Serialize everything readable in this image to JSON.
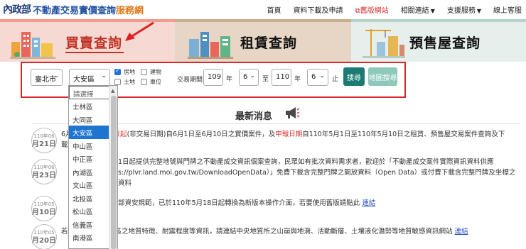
{
  "header": {
    "logo_mark": "內政部",
    "logo_main": "不動產交易實價查詢",
    "logo_accent": "服務網",
    "nav": {
      "home": "首頁",
      "download": "資料下載及申請",
      "old_site": "舊版網站",
      "related": "相關連結",
      "support": "支援服務",
      "service": "線上客服"
    }
  },
  "tabs": {
    "buy": "買賣查詢",
    "rent": "租賃查詢",
    "presale": "預售屋查詢"
  },
  "search": {
    "city": "臺北市",
    "district": "大安區",
    "types": {
      "house": "房地",
      "building": "建物",
      "land": "土地",
      "parking": "車位"
    },
    "period_label": "交易期間：",
    "from_year": "109",
    "from_month": "6",
    "to_year": "110",
    "to_month": "6",
    "year_unit": "年",
    "to_word": "至",
    "end_word": "止",
    "search_button": "搜尋",
    "map_button": "地圖搜尋"
  },
  "district_options": [
    "請選擇",
    "士林區",
    "大同區",
    "大安區",
    "中山區",
    "中正區",
    "內湖區",
    "文山區",
    "北投區",
    "松山區",
    "信義區",
    "南港區"
  ],
  "news": {
    "title": "最新消息",
    "items": [
      {
        "year_label": "110年06",
        "day_label": "月21日",
        "line1_a": "6月",
        "line1_b": "日起",
        "line1_c": "(非交易日期)自6月1日至6月10日之實價案件，及",
        "line1_d": "申報日期",
        "line1_e": "自110年5月1日至110年5月10日之租賃、預售屋交易案件查詢及下",
        "line2": "載"
      },
      {
        "year_label": "110年06",
        "day_label": "月23日",
        "line1": "1日起提供完整地號與門牌之不動產成交資訊個案查詢，民眾如有批次資料需求者，歡迎於「不動產成交案件實際資訊資料供應",
        "line2": "s://plvr.land.moi.gov.tw/DownloadOpenData）」免費下載含完整門牌之開放資料（Open Data）或付費下載含完整門牌及坐標之",
        "line3": "資料"
      },
      {
        "year_label": "110年05",
        "day_label": "月10日",
        "line1": "部資安規範，已於110年5月18日起轉換為新版本操作介面，若要使用舊版請點此",
        "link": "連結"
      },
      {
        "year_label": "110年05",
        "day_label": "月20日",
        "prefix": "若",
        "line1": "區之地質特徵、耐震程度等資訊，請連結中央地質所之山崩與地滑、活動斷層、土壤液化潛勢等地質敏感資訊網站",
        "link": "連結"
      }
    ]
  },
  "colors": {
    "brand_blue": "#1e4fa3",
    "brand_orange": "#e07a1a",
    "highlight_red": "#d9262a",
    "primary_button": "#1b7b72",
    "selected_option": "#1e74d1"
  }
}
